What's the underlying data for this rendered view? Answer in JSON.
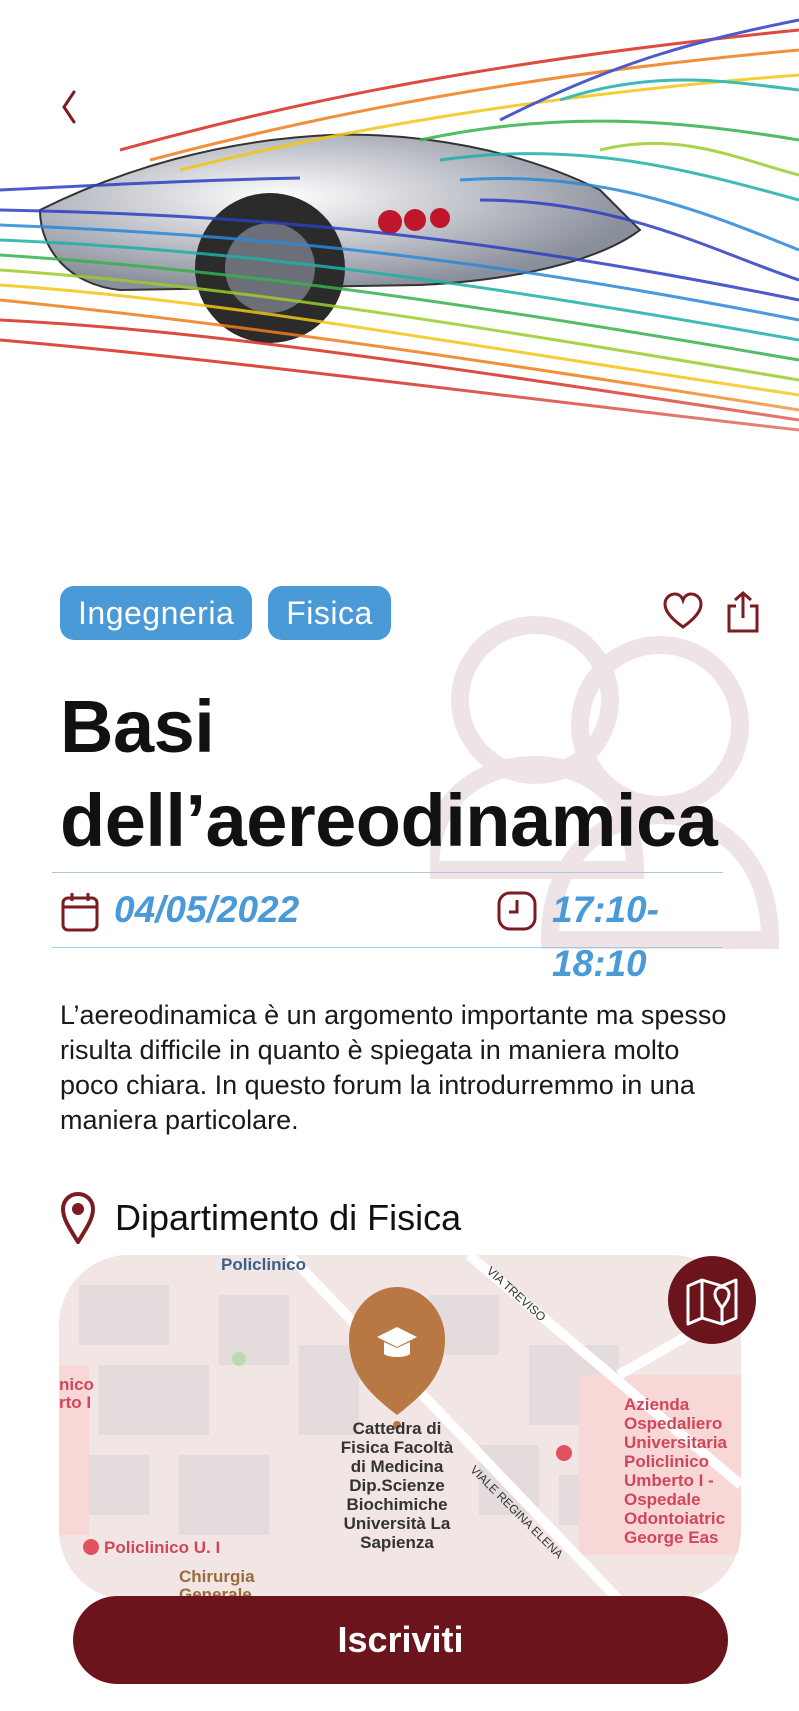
{
  "tags": [
    "Ingegneria",
    "Fisica"
  ],
  "event": {
    "title_line1": "Basi",
    "title_line2": "dell’aereodinamica",
    "date": "04/05/2022",
    "time": "17:10- 18:10",
    "description": "L’aereodinamica è un argomento importante ma spesso risulta difficile in quanto è spiegata in maniera molto poco chiara. In questo forum la introdurremmo in una maniera particolare.",
    "location": "Dipartimento di Fisica"
  },
  "map": {
    "labels": {
      "policlinico_top": "Policlinico",
      "via_treviso": "VIA TREVISO",
      "viale_regina_elena": "VIALE REGINA ELENA",
      "left_partial_1": "nico",
      "left_partial_2": "rto I",
      "policlinico_u": "Policlinico U. I",
      "chirurgia_1": "Chirurgia",
      "chirurgia_2": "Generale",
      "azienda": [
        "Azienda",
        "Ospedaliero",
        "Universitaria",
        "Policlinico",
        "Umberto I -",
        "Ospedale",
        "Odontoiatric",
        "George Eas"
      ],
      "cattedra": [
        "Cattedra di",
        "Fisica Facoltà",
        "di Medicina",
        "Dip.Scienze",
        "Biochimiche",
        "Università La",
        "Sapienza"
      ]
    }
  },
  "cta_label": "Iscriviti",
  "colors": {
    "accent_blue": "#4a9ad7",
    "brand_maroon": "#6b141c",
    "map_marker": "#b87843"
  },
  "icons": {
    "back": "chevron-left-icon",
    "favorite": "heart-icon",
    "share": "share-icon",
    "date": "calendar-icon",
    "time": "clock-icon",
    "location": "map-pin-icon",
    "map": "map-icon",
    "marker": "graduation-cap-icon"
  }
}
